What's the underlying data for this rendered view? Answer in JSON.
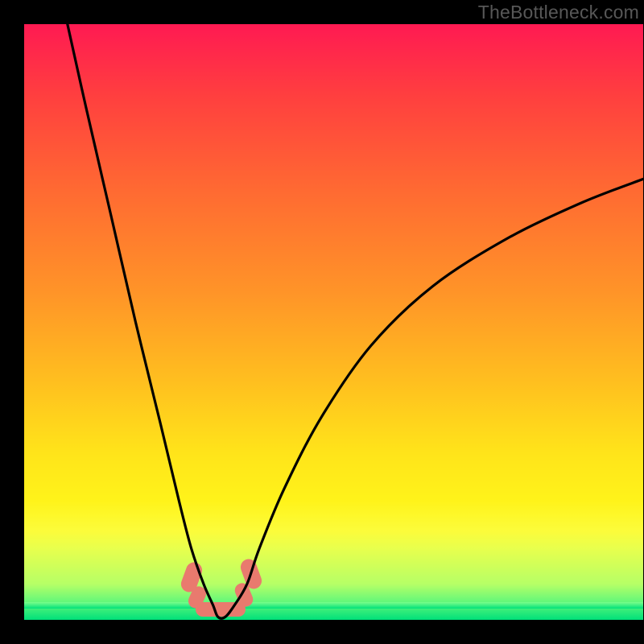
{
  "watermark": "TheBottleneck.com",
  "chart_data": {
    "type": "line",
    "title": "",
    "xlabel": "",
    "ylabel": "",
    "xlim": [
      0,
      100
    ],
    "ylim": [
      0,
      100
    ],
    "grid": false,
    "legend": false,
    "series": [
      {
        "name": "curve",
        "x": [
          7,
          10,
          14,
          18,
          22,
          25,
          27,
          29,
          30.5,
          31.3,
          32.5,
          34,
          36,
          38,
          42,
          48,
          56,
          66,
          78,
          90,
          100
        ],
        "y": [
          100,
          86,
          68,
          50,
          33,
          20,
          12,
          6,
          2.5,
          0.5,
          0.5,
          2.5,
          6,
          12,
          22,
          34,
          46,
          56,
          64,
          70,
          74
        ]
      }
    ],
    "markers": {
      "name": "dip-marker",
      "color": "#e97a6e",
      "approx_x_range": [
        27,
        36
      ],
      "approx_y_range": [
        0,
        10
      ]
    },
    "background_gradient": {
      "top": "#ff1a52",
      "mid": "#ffe41a",
      "bottom": "#00e07a"
    }
  }
}
